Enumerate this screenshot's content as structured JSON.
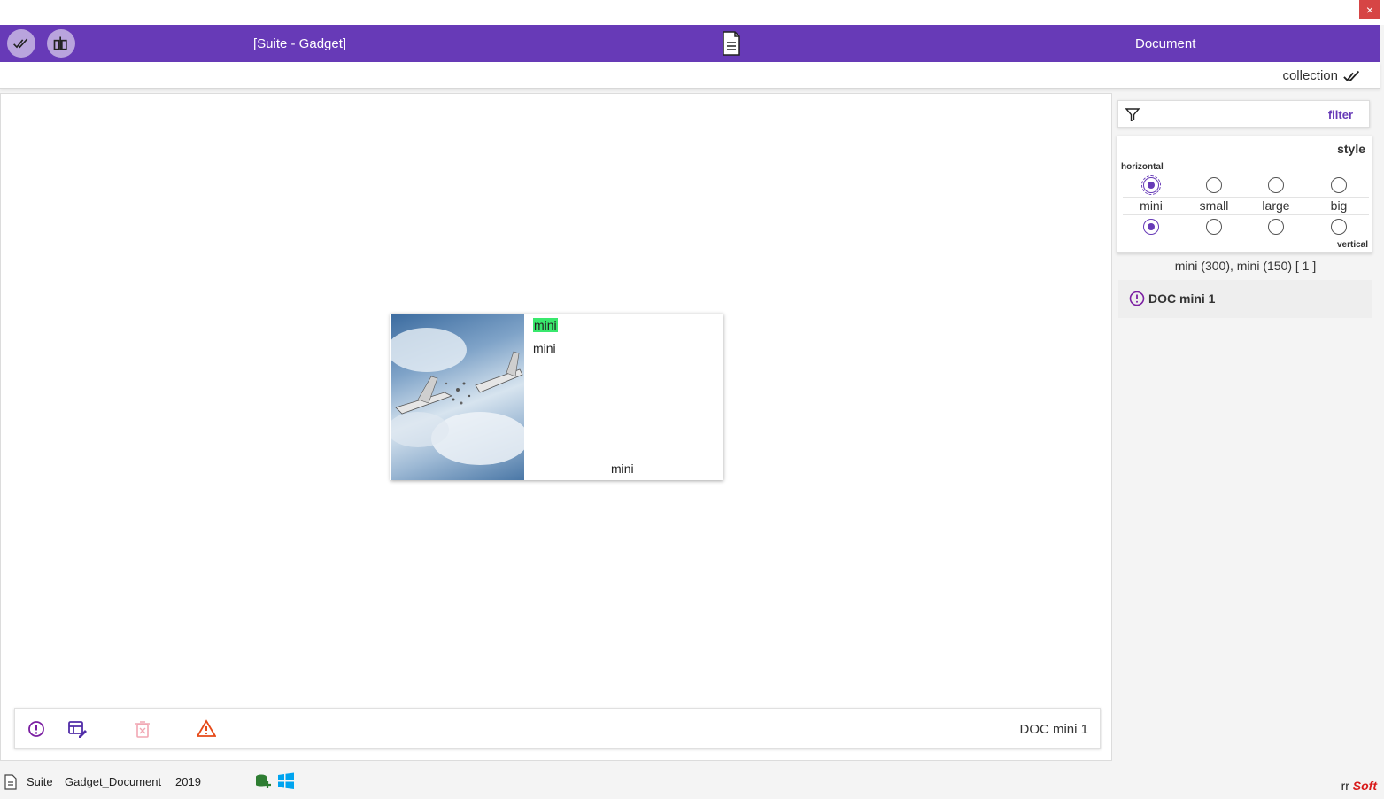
{
  "window": {
    "close_label": "×"
  },
  "header": {
    "title": "[Suite - Gadget]",
    "right_title": "Document",
    "btn_check_icon": "double-check-icon",
    "btn_compare_icon": "compare-icon",
    "doc_icon": "document-icon"
  },
  "subheader": {
    "collection_label": "collection"
  },
  "card": {
    "tag": "mini",
    "subtitle": "mini",
    "footer": "mini"
  },
  "actionbar": {
    "label": "DOC mini 1",
    "icons": [
      "info-circle-icon",
      "edit-table-icon",
      "delete-icon",
      "warning-icon"
    ]
  },
  "filter": {
    "label": "filter"
  },
  "style": {
    "title": "style",
    "horizontal_label": "horizontal",
    "vertical_label": "vertical",
    "sizes": [
      "mini",
      "small",
      "large",
      "big"
    ],
    "horizontal_selected": "mini",
    "vertical_selected": "mini"
  },
  "summary": {
    "text": "mini (300), mini (150)  [ 1 ]"
  },
  "doc_list": [
    {
      "label": "DOC mini 1"
    }
  ],
  "statusbar": {
    "suite": "Suite",
    "document": "Gadget_Document",
    "year": "2019",
    "brand_prefix": "rr",
    "brand_suffix": "Soft"
  },
  "colors": {
    "accent": "#673ab7",
    "highlight": "#39e86d",
    "close": "#d64545",
    "brand_red": "#d91a1a"
  }
}
